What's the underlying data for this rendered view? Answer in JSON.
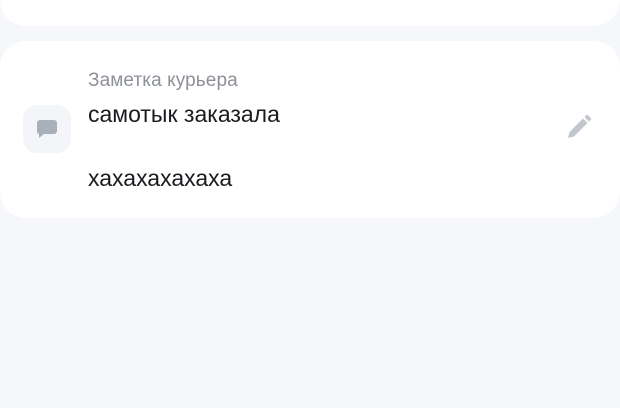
{
  "note": {
    "label": "Заметка курьера",
    "line1": "самотык заказала",
    "line2": "хахахахахаха",
    "icon": "chat-bubble-icon"
  },
  "actions": {
    "edit_icon": "pencil-icon"
  },
  "colors": {
    "page_background": "#f6f7fb",
    "card_background": "#ffffff",
    "icon_gray": "#a9b0ba",
    "label_gray": "#8d9197",
    "text_dark": "#1a1b1f"
  }
}
